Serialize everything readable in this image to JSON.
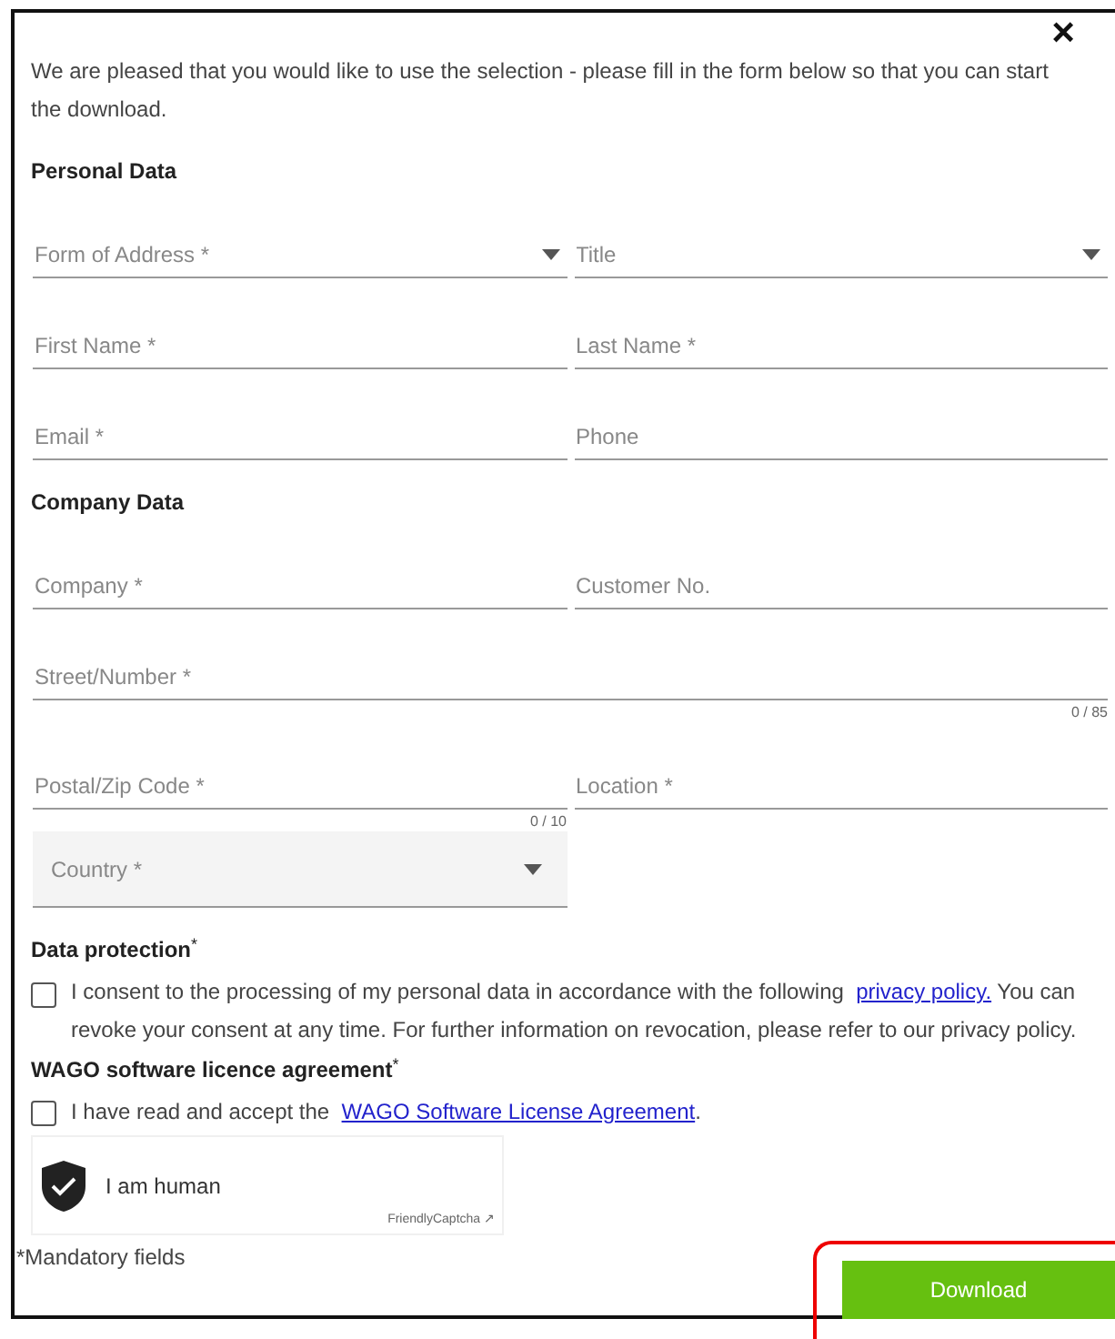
{
  "close_button": {
    "label": "×"
  },
  "intro": "We are pleased that you would like to use the selection - please fill in the form below so that you can start the download.",
  "sections": [
    {
      "heading": "Personal Data",
      "rows": [
        [
          {
            "kind": "select",
            "placeholder": "Form of Address *"
          },
          {
            "kind": "select",
            "placeholder": "Title"
          }
        ],
        [
          {
            "kind": "text",
            "placeholder": "First Name *"
          },
          {
            "kind": "text",
            "placeholder": "Last Name *"
          }
        ],
        [
          {
            "kind": "text",
            "placeholder": "Email *"
          },
          {
            "kind": "text",
            "placeholder": "Phone"
          }
        ]
      ]
    },
    {
      "heading": "Company Data",
      "rows": [
        [
          {
            "kind": "text",
            "placeholder": "Company *"
          },
          {
            "kind": "text",
            "placeholder": "Customer No."
          }
        ],
        [
          {
            "kind": "text",
            "placeholder": "Street/Number *",
            "counter": "0 / 85",
            "wide": true
          }
        ],
        [
          {
            "kind": "text",
            "placeholder": "Postal/Zip Code *",
            "counter": "0 / 10"
          },
          {
            "kind": "text",
            "placeholder": "Location *"
          }
        ],
        [
          {
            "kind": "filled-select",
            "placeholder": "Country *"
          }
        ]
      ]
    }
  ],
  "consents": [
    {
      "heading": "Data protection",
      "heading_mark": "*",
      "checked": false,
      "text_before": "I consent to the processing of my personal data in accordance with the following",
      "link": "privacy policy.",
      "text_after": "You can revoke your consent at any time. For further information on revocation, please refer to our privacy policy."
    },
    {
      "heading": "WAGO software licence agreement",
      "heading_mark": "*",
      "checked": false,
      "text_before": "I have read and accept the",
      "link": "WAGO Software License Agreement",
      "text_after": "."
    }
  ],
  "captcha": {
    "label": "I am human",
    "brand": "FriendlyCaptcha ↗"
  },
  "mandatory_note": "*Mandatory fields",
  "download_button": {
    "label": "Download"
  }
}
